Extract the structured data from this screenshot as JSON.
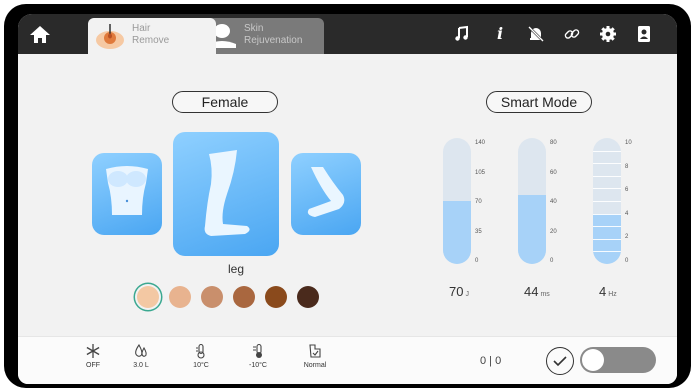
{
  "tabs": [
    {
      "label": "Hair\nRemove",
      "active": true
    },
    {
      "label": "Skin\nRejuvenation",
      "active": false
    }
  ],
  "topbar_icons": [
    "music-note-icon",
    "info-icon",
    "alarm-off-icon",
    "link-icon",
    "gear-icon",
    "profile-icon"
  ],
  "gender": "Female",
  "mode": "Smart Mode",
  "selected_area": "leg",
  "skin_tones": [
    "#f3c8a3",
    "#e8b38f",
    "#c98f6c",
    "#a9673f",
    "#8a4a1c",
    "#4a2a1c"
  ],
  "selected_skin_tone_index": 0,
  "gauges": [
    {
      "name": "energy",
      "ticks": [
        "140",
        "105",
        "70",
        "35",
        "0"
      ],
      "max": 140,
      "value": 70,
      "value_label": "70",
      "unit": "J"
    },
    {
      "name": "pulse-width",
      "ticks": [
        "80",
        "60",
        "40",
        "20",
        "0"
      ],
      "max": 80,
      "value": 44,
      "value_label": "44",
      "unit": "ms"
    },
    {
      "name": "frequency",
      "ticks": [
        "10",
        "8",
        "6",
        "4",
        "2",
        "0"
      ],
      "max": 10,
      "value": 4,
      "value_label": "4",
      "unit": "Hz"
    }
  ],
  "bottom": {
    "items": [
      {
        "icon": "snowflake-icon",
        "label": "OFF"
      },
      {
        "icon": "water-drop-icon",
        "label": "3.0 L"
      },
      {
        "icon": "thermometer-icon",
        "label": "10°C"
      },
      {
        "icon": "thermometer-low-icon",
        "label": "-10°C"
      },
      {
        "icon": "hand-icon",
        "label": "Normal"
      }
    ],
    "counter": "0 | 0",
    "toggle_on": false
  },
  "colors": {
    "accent": "#4aa6f2",
    "gauge_fill": "#a7d2f8",
    "selected_ring": "#3aa890"
  }
}
